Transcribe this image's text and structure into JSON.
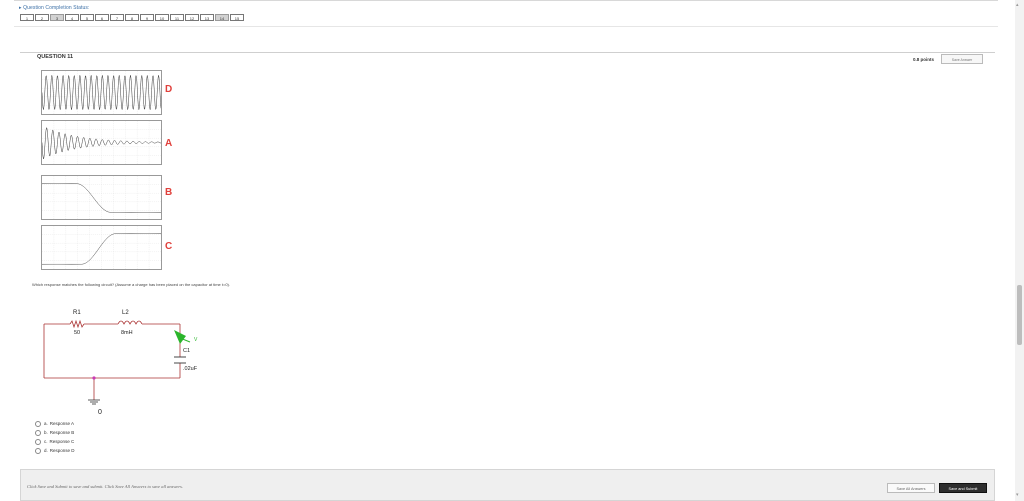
{
  "status": {
    "label": "Question Completion Status:"
  },
  "question_nav": [
    {
      "num": "1",
      "answered": false
    },
    {
      "num": "2",
      "answered": false
    },
    {
      "num": "3",
      "answered": true
    },
    {
      "num": "4",
      "answered": false
    },
    {
      "num": "5",
      "answered": false
    },
    {
      "num": "6",
      "answered": false
    },
    {
      "num": "7",
      "answered": false
    },
    {
      "num": "8",
      "answered": false
    },
    {
      "num": "9",
      "answered": false
    },
    {
      "num": "10",
      "answered": false
    },
    {
      "num": "11",
      "answered": false
    },
    {
      "num": "12",
      "answered": false
    },
    {
      "num": "13",
      "answered": false
    },
    {
      "num": "14",
      "answered": true
    },
    {
      "num": "15",
      "answered": false
    }
  ],
  "question": {
    "title": "QUESTION 11",
    "points": "0.8 points",
    "save_answer": "Save Answer",
    "text": "Which response matches the following circuit? (Assume a charge has been placed on the capacitor at time t=0)."
  },
  "responses": [
    {
      "letter": "D",
      "kind": "oscillate"
    },
    {
      "letter": "A",
      "kind": "damped"
    },
    {
      "letter": "B",
      "kind": "fall"
    },
    {
      "letter": "C",
      "kind": "rise"
    }
  ],
  "circuit": {
    "r1_label": "R1",
    "r1_value": "50",
    "l2_label": "L2",
    "l2_value": "8mH",
    "c1_label": "C1",
    "c1_value": ".02uF",
    "ground_label": "0"
  },
  "options": [
    {
      "key": "a.",
      "text": "Response A"
    },
    {
      "key": "b.",
      "text": "Response B"
    },
    {
      "key": "c.",
      "text": "Response C"
    },
    {
      "key": "d.",
      "text": "Response D"
    }
  ],
  "footer": {
    "help_text": "Click Save and Submit to save and submit. Click Save All Answers to save all answers.",
    "save_all": "Save All Answers",
    "save_submit": "Save and Submit"
  },
  "colors": {
    "response_letter": "#e0403b",
    "probe": "#2bb52b",
    "node_dot": "#c93bb5",
    "submit_bg": "#2e2e2e"
  }
}
